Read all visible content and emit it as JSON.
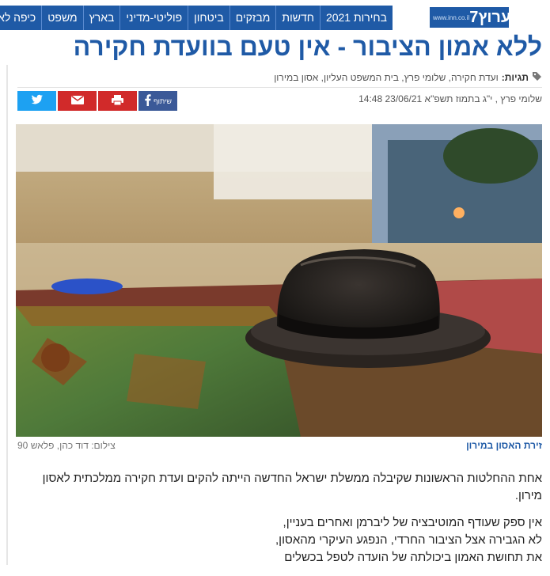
{
  "site": {
    "logo_text": "ערוץ7",
    "logo_url": "www.inn.co.il"
  },
  "nav": {
    "items": [
      "בחירות 2021",
      "חדשות",
      "מבזקים",
      "ביטחון",
      "פוליטי-מדיני",
      "בארץ",
      "משפט",
      "כיפה לא"
    ]
  },
  "article": {
    "headline": "ללא אמון הציבור - אין טעם בוועדת חקירה",
    "tags_label": "תגיות:",
    "tags": "ועדת חקירה, שלומי פרץ, בית המשפט העליון, אסון במירון",
    "byline": "שלומי פרץ , י\"ג בתמוז תשפ\"א 23/06/21 14:48",
    "share": {
      "fb_label": "שיתוף"
    },
    "image_series": "זירת האסון במירון",
    "image_credit": "צילום: דוד כהן, פלאש 90",
    "paragraph1": "אחת ההחלטות הראשונות שקיבלה ממשלת ישראל החדשה הייתה להקים ועדת חקירה ממלכתית לאסון מירון.",
    "paragraph2_lines": [
      "אין ספק שעודף המוטיבציה של ליברמן ואחרים בעניין,",
      "לא הגבירה אצל הציבור החרדי, הנפגע העיקרי מהאסון,",
      "את תחושת האמון ביכולתה של הועדה לטפל בכשלים"
    ]
  },
  "colors": {
    "brand_blue": "#1f5aa6",
    "twitter": "#1da1f2",
    "red": "#d12a2a",
    "facebook": "#3b5998"
  },
  "icons": [
    "tag-icon",
    "twitter-icon",
    "mail-icon",
    "print-icon",
    "facebook-icon"
  ]
}
